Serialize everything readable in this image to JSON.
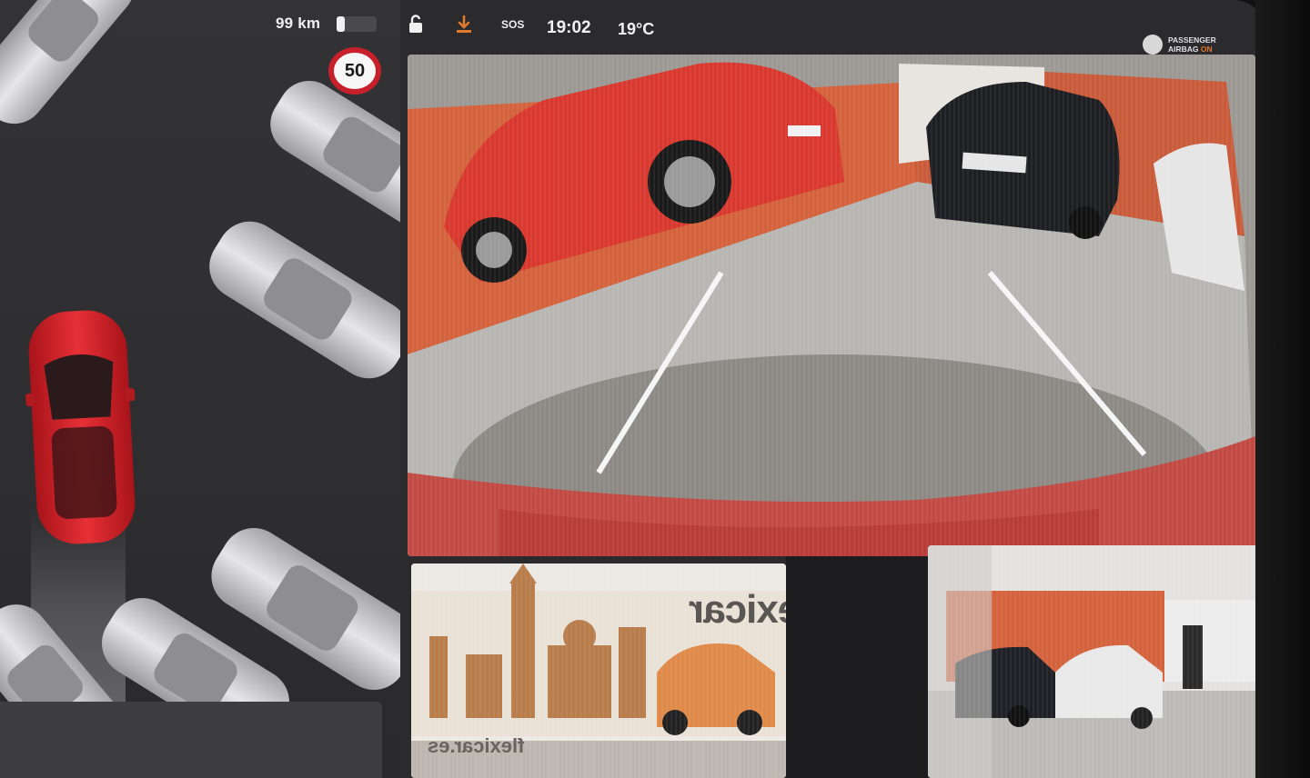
{
  "status_bar": {
    "range": "99 km",
    "battery_level_percent": 20,
    "lock_icon": "unlocked-lock-icon",
    "download_icon": "download-icon",
    "sos": "SOS",
    "time": "19:02",
    "temperature": "19°C"
  },
  "speed_limit": "50",
  "airbag": {
    "line1": "PASSENGER",
    "line2_prefix": "AIRBAG",
    "line2_state": "ON"
  },
  "cameras": {
    "left_repeater": {
      "sign_text": "flexicar",
      "url_text": "flexicar.es"
    }
  },
  "colors": {
    "ego_car": "#d4232a",
    "warning_orange": "#e07a2e",
    "speed_sign_ring": "#c8202a",
    "screen_bg": "#2b2b2d"
  }
}
